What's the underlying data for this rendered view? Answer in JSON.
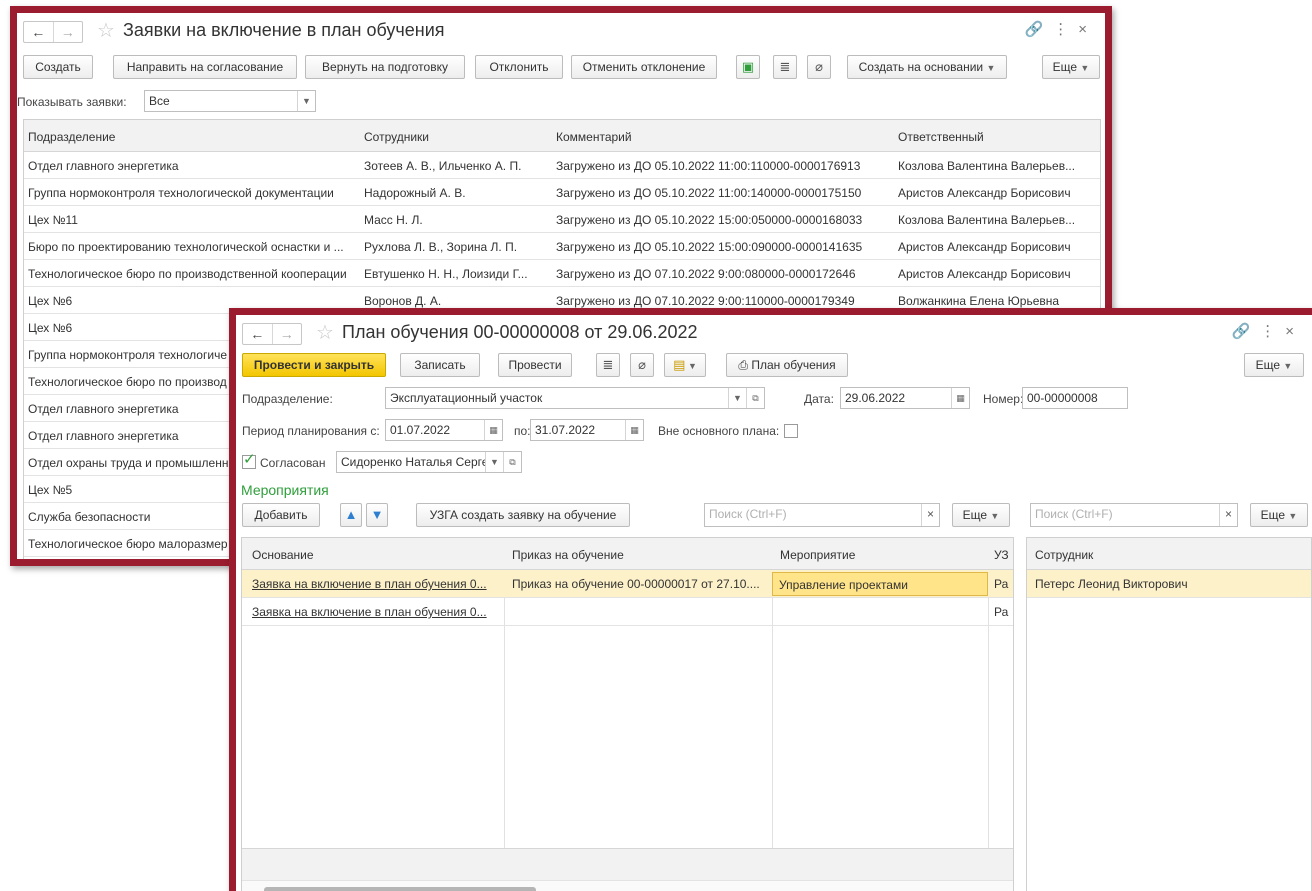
{
  "w1": {
    "title": "Заявки на включение в план обучения",
    "nav_back": "←",
    "nav_forward": "→",
    "toolbar": {
      "create": "Создать",
      "send": "Направить на согласование",
      "return": "Вернуть на подготовку",
      "reject": "Отклонить",
      "cancel_reject": "Отменить отклонение",
      "create_based": "Создать на основании",
      "more": "Еще"
    },
    "filter": {
      "label": "Показывать заявки:",
      "value": "Все"
    },
    "table": {
      "headers": [
        "Подразделение",
        "Сотрудники",
        "Комментарий",
        "Ответственный"
      ],
      "rows": [
        [
          "Отдел главного энергетика",
          "Зотеев А. В., Ильченко А. П.",
          "Загружено из ДО 05.10.2022 11:00:110000-0000176913",
          "Козлова Валентина Валерьев..."
        ],
        [
          "Группа нормоконтроля технологической документации",
          "Надорожный А. В.",
          "Загружено из ДО 05.10.2022 11:00:140000-0000175150",
          "Аристов Александр Борисович"
        ],
        [
          "Цех №11",
          "Масс Н. Л.",
          "Загружено из ДО 05.10.2022 15:00:050000-0000168033",
          "Козлова Валентина Валерьев..."
        ],
        [
          "Бюро по проектированию технологической оснастки и ...",
          "Рухлова Л. В., Зорина Л. П.",
          "Загружено из ДО 05.10.2022 15:00:090000-0000141635",
          "Аристов Александр Борисович"
        ],
        [
          "Технологическое бюро по производственной кооперации",
          "Евтушенко Н. Н., Лоизиди Г...",
          "Загружено из ДО 07.10.2022 9:00:080000-0000172646",
          "Аристов Александр Борисович"
        ],
        [
          "Цех №6",
          "Воронов Д. А.",
          "Загружено из ДО 07.10.2022 9:00:110000-0000179349",
          "Волжанкина Елена Юрьевна"
        ],
        [
          "Цех №6",
          "",
          "",
          ""
        ],
        [
          "Группа нормоконтроля технологиче",
          "",
          "",
          ""
        ],
        [
          "Технологическое бюро по производ",
          "",
          "",
          ""
        ],
        [
          "Отдел главного энергетика",
          "",
          "",
          ""
        ],
        [
          "Отдел главного энергетика",
          "",
          "",
          ""
        ],
        [
          "Отдел охраны труда и промышленн",
          "",
          "",
          ""
        ],
        [
          "Цех №5",
          "",
          "",
          ""
        ],
        [
          "Служба безопасности",
          "",
          "",
          ""
        ],
        [
          "Технологическое бюро малоразмер",
          "",
          "",
          ""
        ]
      ]
    }
  },
  "w2": {
    "title": "План обучения 00-00000008 от 29.06.2022",
    "nav_back": "←",
    "nav_forward": "→",
    "toolbar": {
      "post_close": "Провести и закрыть",
      "save": "Записать",
      "post": "Провести",
      "plan_print": "План обучения",
      "more": "Еще"
    },
    "form": {
      "dept_label": "Подразделение:",
      "dept_value": "Эксплуатационный участок",
      "date_label": "Дата:",
      "date_value": "29.06.2022",
      "number_label": "Номер:",
      "number_value": "00-00000008",
      "period_label": "Период планирования с:",
      "period_from": "01.07.2022",
      "period_to_label": "по:",
      "period_to": "31.07.2022",
      "outside_label": "Вне основного плана:",
      "approved_label": "Согласован",
      "approved_by": "Сидоренко Наталья Серге"
    },
    "events": {
      "section_title": "Мероприятия",
      "add": "Добавить",
      "create_request": "УЗГА создать заявку на обучение",
      "search_placeholder": "Поиск (Ctrl+F)",
      "more": "Еще",
      "headers": [
        "Основание",
        "Приказ на обучение",
        "Мероприятие",
        "УЗ"
      ],
      "rows": [
        [
          "Заявка на включение в план обучения 0...",
          "Приказ на обучение 00-00000017 от 27.10....",
          "Управление проектами",
          "Ра"
        ],
        [
          "Заявка на включение в план обучения 0...",
          "",
          "",
          "Ра"
        ]
      ]
    },
    "employees": {
      "search_placeholder": "Поиск (Ctrl+F)",
      "more": "Еще",
      "header": "Сотрудник",
      "rows": [
        "Петерс Леонид Викторович"
      ]
    }
  },
  "colors": {
    "frame": "#9b1c2e",
    "selection": "#fdf1c9",
    "primary": "#f3c600",
    "green": "#2e9f3a"
  }
}
